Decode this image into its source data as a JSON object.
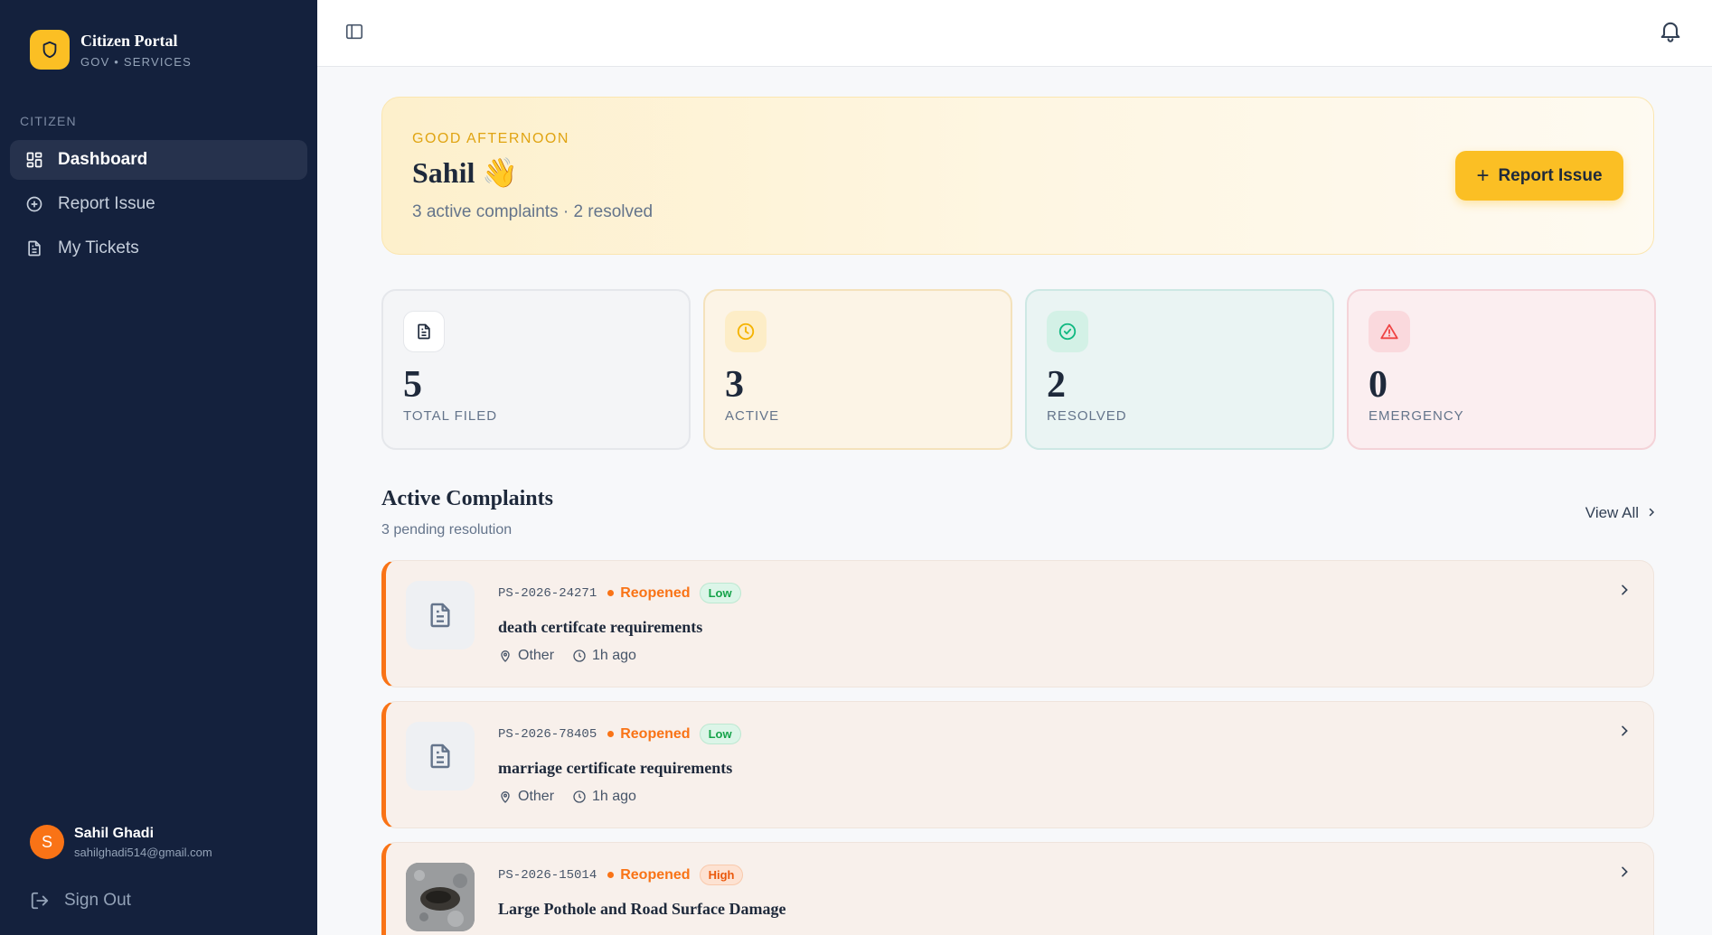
{
  "sidebar": {
    "brand_title": "Citizen Portal",
    "brand_subtitle": "GOV • SERVICES",
    "section_label": "CITIZEN",
    "items": [
      {
        "label": "Dashboard",
        "icon": "grid-icon",
        "active": true
      },
      {
        "label": "Report Issue",
        "icon": "plus-circle-icon",
        "active": false
      },
      {
        "label": "My Tickets",
        "icon": "document-icon",
        "active": false
      }
    ],
    "user": {
      "initial": "S",
      "name": "Sahil Ghadi",
      "email": "sahilghadi514@gmail.com"
    },
    "sign_out": "Sign Out"
  },
  "greeting": {
    "label": "GOOD AFTERNOON",
    "name": "Sahil 👋",
    "summary": "3 active complaints · 2 resolved",
    "button": "Report Issue"
  },
  "stats": [
    {
      "value": "5",
      "label": "TOTAL FILED",
      "icon": "document-icon",
      "color": "#1e293b"
    },
    {
      "value": "3",
      "label": "ACTIVE",
      "icon": "clock-icon",
      "color": "#f5b301"
    },
    {
      "value": "2",
      "label": "RESOLVED",
      "icon": "check-circle-icon",
      "color": "#10b981"
    },
    {
      "value": "0",
      "label": "EMERGENCY",
      "icon": "alert-triangle-icon",
      "color": "#ef4444"
    }
  ],
  "complaints_section": {
    "title": "Active Complaints",
    "subtitle": "3 pending resolution",
    "view_all": "View All"
  },
  "complaints": [
    {
      "id": "PS-2026-24271",
      "status": "Reopened",
      "priority": "Low",
      "title": "death certifcate requirements",
      "category": "Other",
      "time": "1h ago"
    },
    {
      "id": "PS-2026-78405",
      "status": "Reopened",
      "priority": "Low",
      "title": "marriage certificate requirements",
      "category": "Other",
      "time": "1h ago"
    },
    {
      "id": "PS-2026-15014",
      "status": "Reopened",
      "priority": "High",
      "title": "Large Pothole and Road Surface Damage",
      "category": "",
      "time": ""
    }
  ],
  "colors": {
    "sidebar_bg": "#14213d",
    "accent": "#fbbf24",
    "status": "#f97316"
  }
}
